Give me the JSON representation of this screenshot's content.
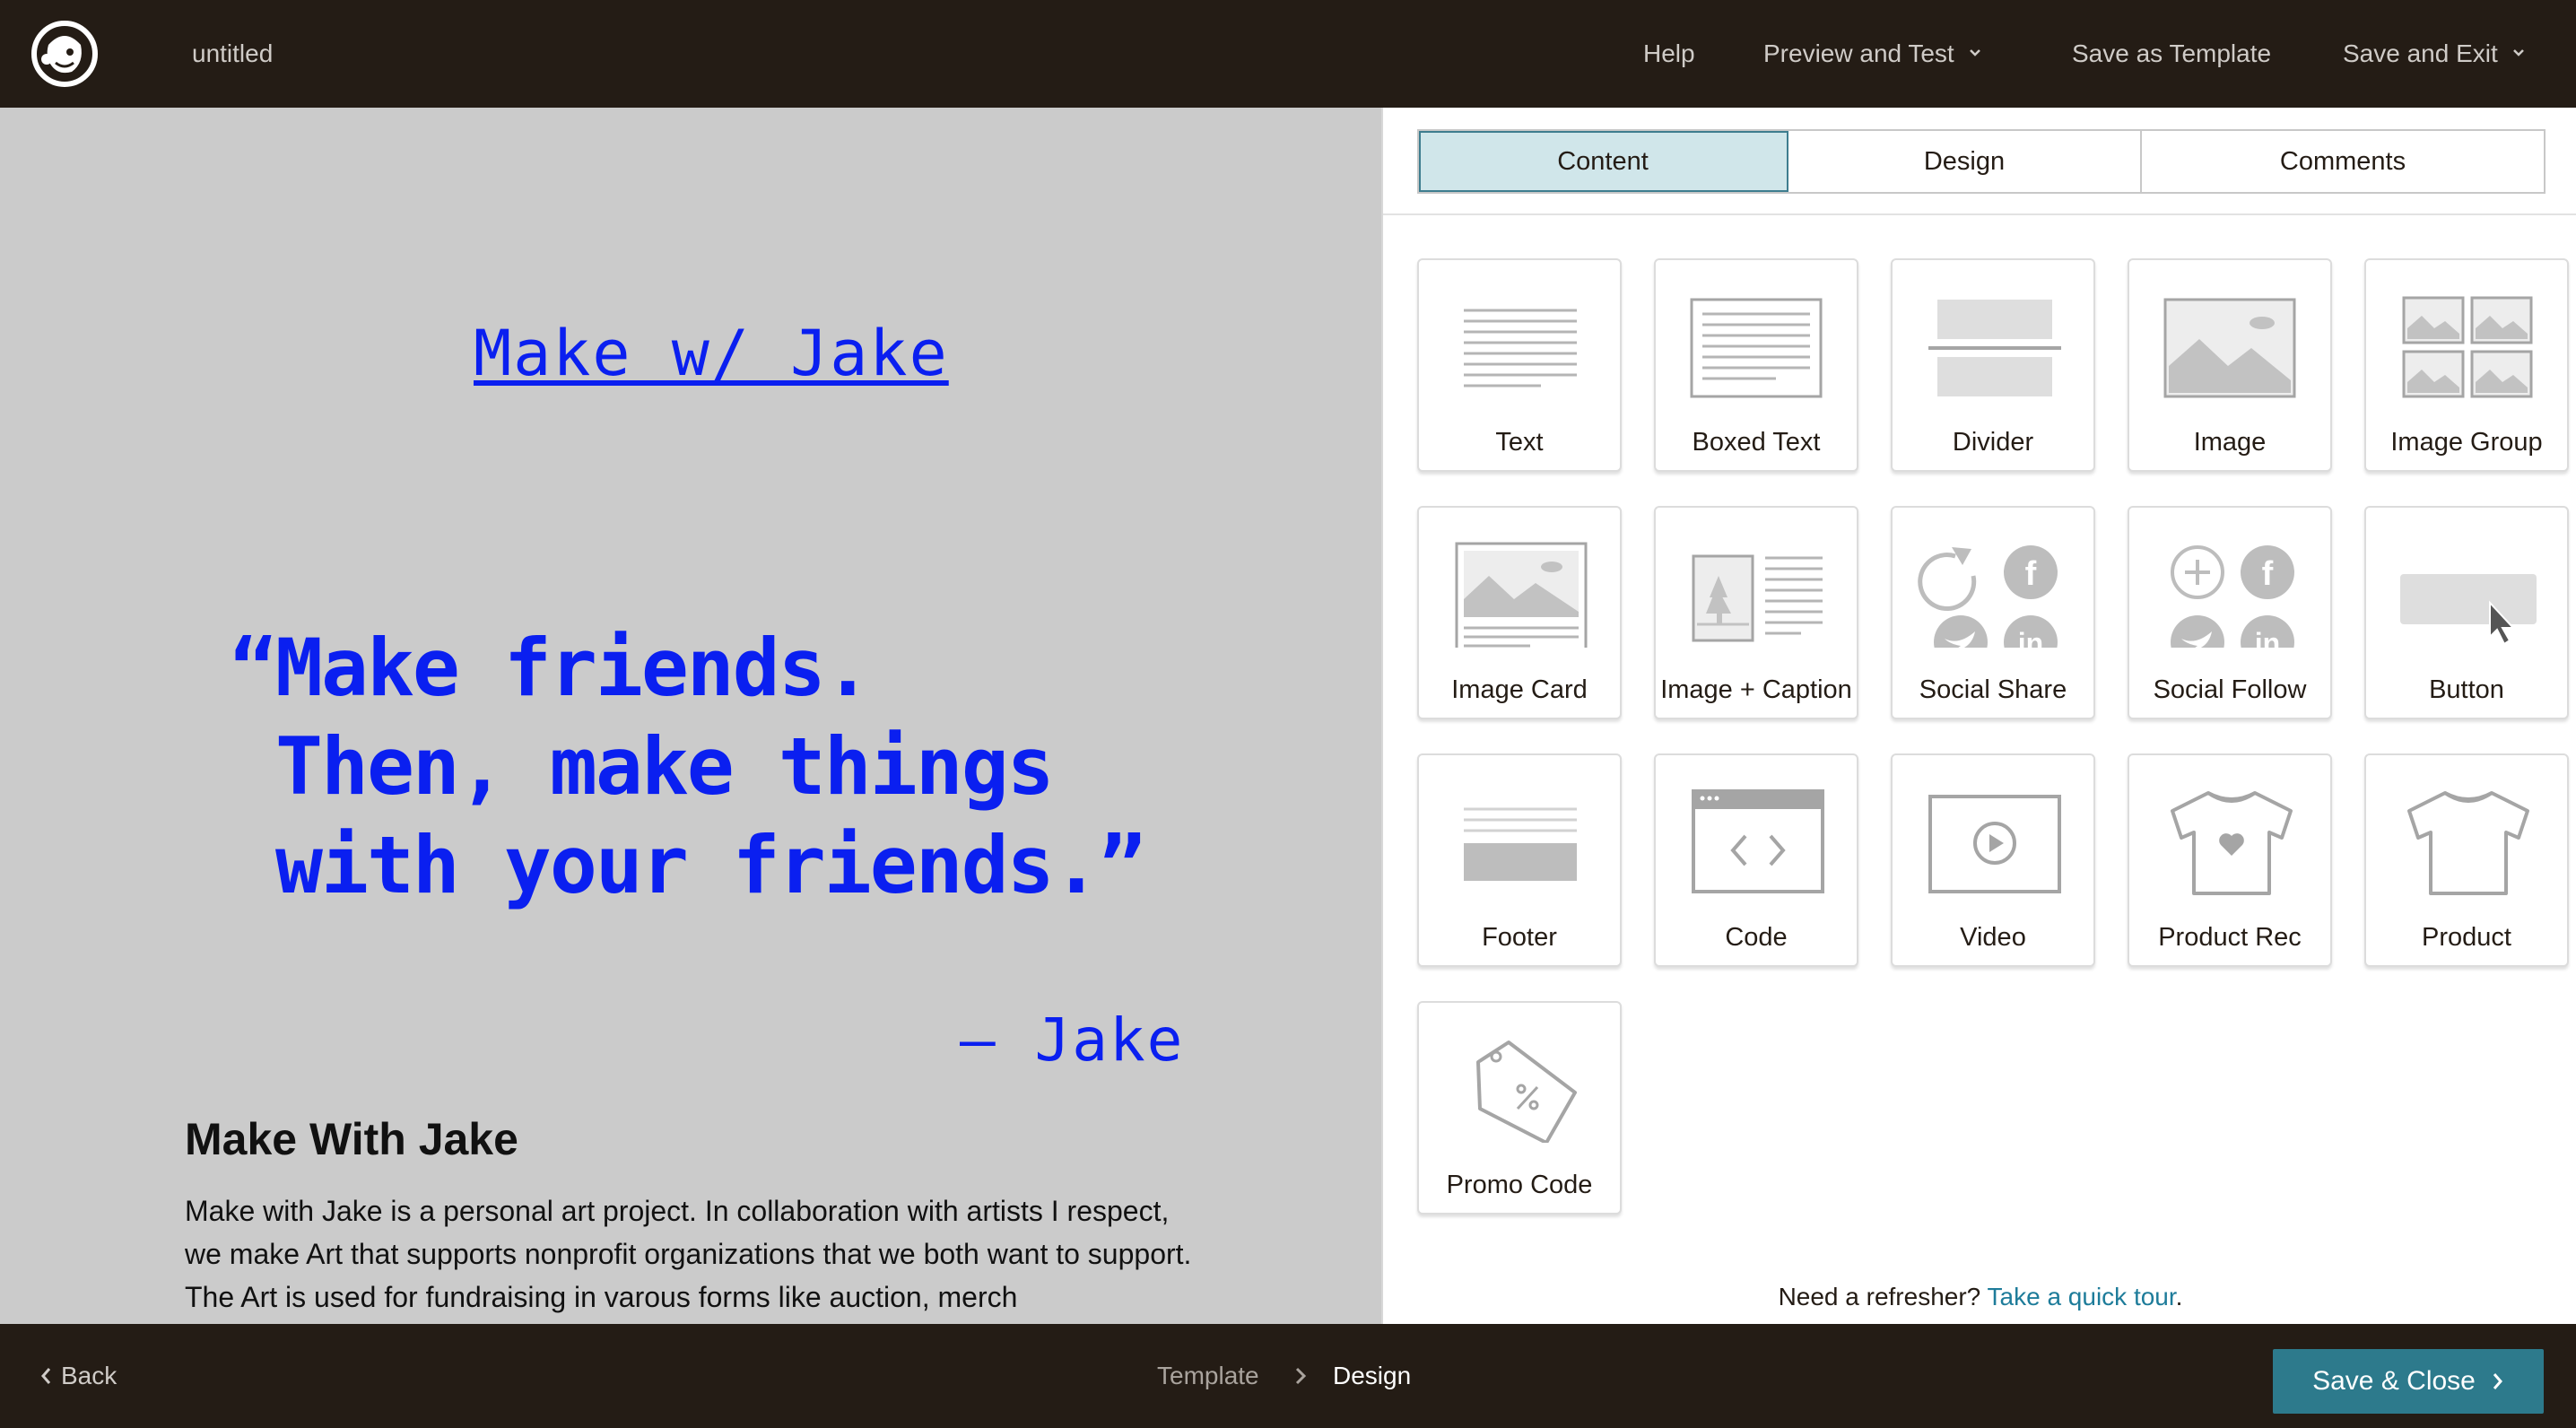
{
  "header": {
    "doc_title": "untitled",
    "nav": {
      "help": "Help",
      "preview_test": "Preview and Test",
      "save_template": "Save as Template",
      "save_exit": "Save and Exit"
    }
  },
  "preview": {
    "link_text": "Make w/ Jake",
    "quote": "“Make friends.\n Then, make things\n with your friends.”",
    "author": "– Jake",
    "heading": "Make With Jake",
    "body": "Make with Jake is a personal art project. In collaboration with artists I respect, we make Art that supports nonprofit organizations that we both want to support. The Art is used for fundraising in varous forms like auction, merch",
    "accent_color": "#0a1ff0",
    "background_color": "#cbcbcb"
  },
  "sidebar": {
    "tabs": [
      "Content",
      "Design",
      "Comments"
    ],
    "active_tab": "Content",
    "blocks": [
      {
        "label": "Text",
        "icon": "text-block-icon"
      },
      {
        "label": "Boxed Text",
        "icon": "boxed-text-block-icon"
      },
      {
        "label": "Divider",
        "icon": "divider-block-icon"
      },
      {
        "label": "Image",
        "icon": "image-block-icon"
      },
      {
        "label": "Image Group",
        "icon": "image-group-block-icon"
      },
      {
        "label": "Image Card",
        "icon": "image-card-block-icon"
      },
      {
        "label": "Image + Caption",
        "icon": "image-caption-block-icon"
      },
      {
        "label": "Social Share",
        "icon": "social-share-block-icon"
      },
      {
        "label": "Social Follow",
        "icon": "social-follow-block-icon"
      },
      {
        "label": "Button",
        "icon": "button-block-icon"
      },
      {
        "label": "Footer",
        "icon": "footer-block-icon"
      },
      {
        "label": "Code",
        "icon": "code-block-icon"
      },
      {
        "label": "Video",
        "icon": "video-block-icon"
      },
      {
        "label": "Product Rec",
        "icon": "product-rec-block-icon"
      },
      {
        "label": "Product",
        "icon": "product-block-icon"
      },
      {
        "label": "Promo Code",
        "icon": "promo-code-block-icon"
      }
    ],
    "refresher": {
      "text": "Need a refresher?",
      "link": "Take a quick tour",
      "suffix": "."
    },
    "link_color": "#1e7c9a",
    "active_tab_color": "#d0e6ea"
  },
  "footer": {
    "back": "Back",
    "breadcrumb": [
      "Template",
      "Design"
    ],
    "save_close": "Save & Close",
    "button_color": "#2d7a8c"
  }
}
